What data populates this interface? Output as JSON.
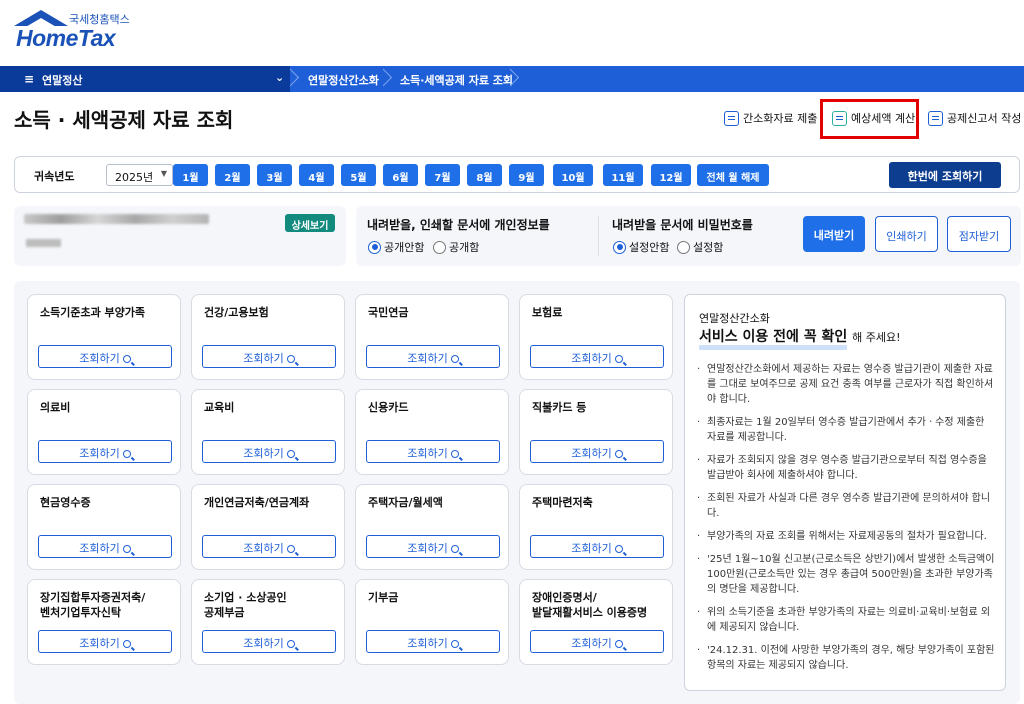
{
  "logo": {
    "sub": "국세청홈택스",
    "brand": "HomeTax"
  },
  "nav": {
    "menu": "연말정산",
    "crumbs": [
      "연말정산간소화",
      "소득·세액공제 자료 조회"
    ]
  },
  "page_title": "소득 · 세액공제 자료 조회",
  "top_actions": [
    "간소화자료 제출",
    "예상세액 계산",
    "공제신고서 작성"
  ],
  "year": {
    "label": "귀속년도",
    "value": "2025년",
    "months": [
      "1월",
      "2월",
      "3월",
      "4월",
      "5월",
      "6월",
      "7월",
      "8월",
      "9월",
      "10월",
      "11월",
      "12월"
    ],
    "clear": "전체 월 해제",
    "query_all": "한번에 조회하기"
  },
  "user": {
    "detail": "상세보기"
  },
  "options": {
    "privacy_q": "내려받을, 인쇄할 문서에 개인정보를",
    "privacy_opts": [
      "공개안함",
      "공개함"
    ],
    "pw_q": "내려받을 문서에 비밀번호를",
    "pw_opts": [
      "설정안함",
      "설정함"
    ],
    "download": "내려받기",
    "print": "인쇄하기",
    "braille": "점자받기"
  },
  "cards": [
    {
      "name": "소득기준초과 부양가족"
    },
    {
      "name": "건강/고용보험"
    },
    {
      "name": "국민연금"
    },
    {
      "name": "보험료"
    },
    {
      "name": "의료비"
    },
    {
      "name": "교육비"
    },
    {
      "name": "신용카드"
    },
    {
      "name": "직불카드 등"
    },
    {
      "name": "현금영수증"
    },
    {
      "name": "개인연금저축/연금계좌"
    },
    {
      "name": "주택자금/월세액"
    },
    {
      "name": "주택마련저축"
    },
    {
      "name": "장기집합투자증권저축/\n벤처기업투자신탁"
    },
    {
      "name": "소기업 · 소상공인\n공제부금"
    },
    {
      "name": "기부금"
    },
    {
      "name": "장애인증명서/\n발달재활서비스 이용증명"
    }
  ],
  "card_btn": "조회하기",
  "notice": {
    "sub": "연말정산간소화",
    "head": "서비스 이용 전에 꼭 확인",
    "head_suffix": "해 주세요!",
    "items": [
      "연말정산간소화에서 제공하는 자료는 영수증 발급기관이 제출한 자료를 그대로 보여주므로 공제 요건 충족 여부를 근로자가 직접 확인하셔야 합니다.",
      "최종자료는 1월 20일부터 영수증 발급기관에서 추가ㆍ수정 제출한 자료를 제공합니다.",
      "자료가 조회되지 않을 경우 영수증 발급기관으로부터 직접 영수증을 발급받아 회사에 제출하셔야 합니다.",
      "조회된 자료가 사실과 다른 경우 영수증 발급기관에 문의하셔야 합니다.",
      "부양가족의 자료 조회를 위해서는 자료제공동의 절차가 필요합니다.",
      "'25년 1월~10월 신고분(근로소득은 상반기)에서 발생한 소득금액이 100만원(근로소득만 있는 경우 총급여 500만원)을 초과한 부양가족의 명단을 제공합니다.",
      "위의 소득기준을 초과한 부양가족의 자료는 의료비·교육비·보험료 외에 제공되지 않습니다.",
      "'24.12.31. 이전에 사망한 부양가족의 경우, 해당 부양가족이 포함된 항목의 자료는 제공되지 않습니다."
    ]
  }
}
